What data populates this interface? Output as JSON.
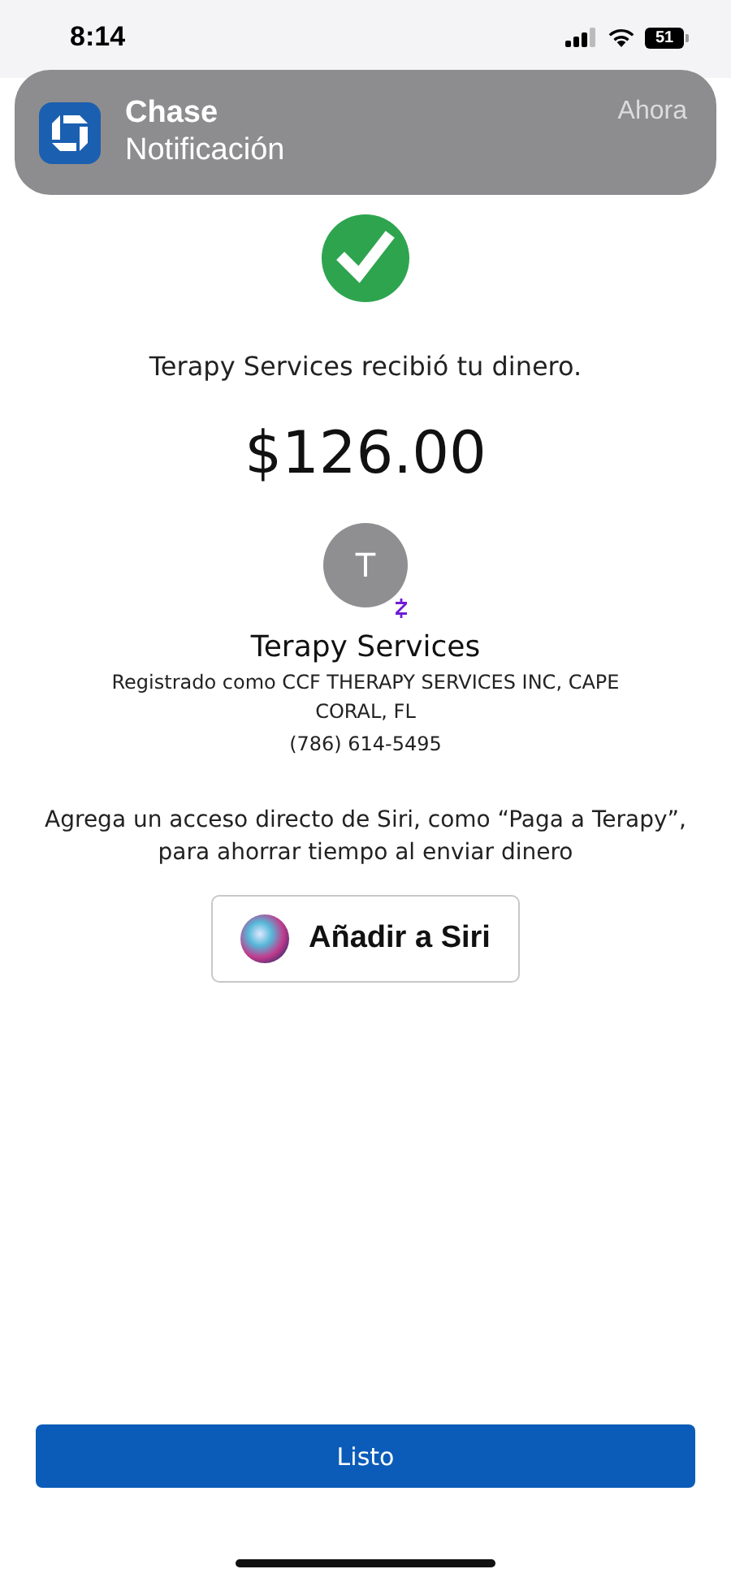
{
  "status_bar": {
    "time": "8:14",
    "battery": "51"
  },
  "notification": {
    "app": "Chase",
    "message": "Notificación",
    "time": "Ahora"
  },
  "confirmation": {
    "message": "Terapy Services recibió tu dinero.",
    "amount": "$126.00"
  },
  "recipient": {
    "initial": "T",
    "name": "Terapy Services",
    "registered": "Registrado como CCF THERAPY SERVICES INC, CAPE CORAL, FL",
    "phone": "(786) 614-5495"
  },
  "siri": {
    "text": "Agrega un acceso directo de Siri, como “Paga a Terapy”, para ahorrar tiempo al enviar dinero",
    "button": "Añadir a Siri"
  },
  "done_button": "Listo"
}
